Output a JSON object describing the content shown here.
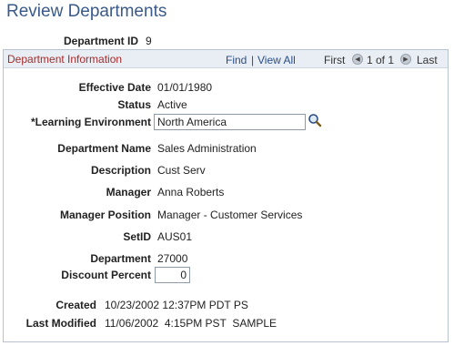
{
  "page": {
    "title": "Review Departments"
  },
  "department_id": {
    "label": "Department ID",
    "value": "9"
  },
  "panel": {
    "title": "Department Information",
    "find": "Find",
    "sep": "|",
    "view_all": "View All",
    "first": "First",
    "pager": "1 of 1",
    "last": "Last"
  },
  "fields": {
    "effective_date": {
      "label": "Effective Date",
      "value": "01/01/1980"
    },
    "status": {
      "label": "Status",
      "value": "Active"
    },
    "learning_environment": {
      "label": "*Learning Environment",
      "value": "North America"
    },
    "department_name": {
      "label": "Department Name",
      "value": "Sales Administration"
    },
    "description": {
      "label": "Description",
      "value": "Cust Serv"
    },
    "manager": {
      "label": "Manager",
      "value": "Anna Roberts"
    },
    "manager_position": {
      "label": "Manager Position",
      "value": "Manager  - Customer Services"
    },
    "setid": {
      "label": "SetID",
      "value": "AUS01"
    },
    "department": {
      "label": "Department",
      "value": "27000"
    },
    "discount_percent": {
      "label": "Discount Percent",
      "value": "0"
    },
    "created": {
      "label": "Created",
      "value": "10/23/2002 12:37PM PDT PS"
    },
    "last_modified": {
      "label": "Last Modified",
      "value": "11/06/2002  4:15PM PST  SAMPLE"
    }
  },
  "icons": {
    "lookup": "magnifier-icon",
    "prev": "left-arrow-icon",
    "next": "right-arrow-icon"
  },
  "colors": {
    "title": "#3a5a8a",
    "panel_title": "#a32c2c",
    "link": "#2b4d86",
    "panel_border": "#b9c3cf",
    "panel_header_bg": "#e9eef4"
  }
}
